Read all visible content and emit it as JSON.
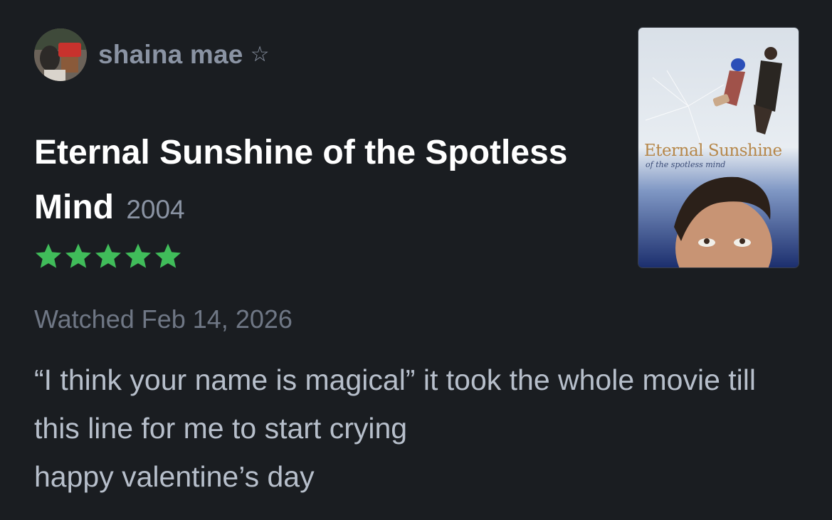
{
  "user": {
    "name": "shaina mae",
    "star_glyph": "☆"
  },
  "film": {
    "title": "Eternal Sunshine of the Spotless Mind",
    "year": "2004",
    "rating_stars": 5,
    "star_color": "#40bc5a"
  },
  "watched": "Watched Feb 14, 2026",
  "review": {
    "lines": [
      "“I think your name is magical” it took the whole movie till this line for me to start crying",
      "happy valentine’s day"
    ]
  },
  "poster": {
    "title": "Eternal Sunshine",
    "subtitle": "of the spotless mind"
  },
  "colors": {
    "background": "#1a1d21",
    "muted_text": "#8a93a3",
    "body_text": "#b7bfcb",
    "title_text": "#ffffff"
  }
}
